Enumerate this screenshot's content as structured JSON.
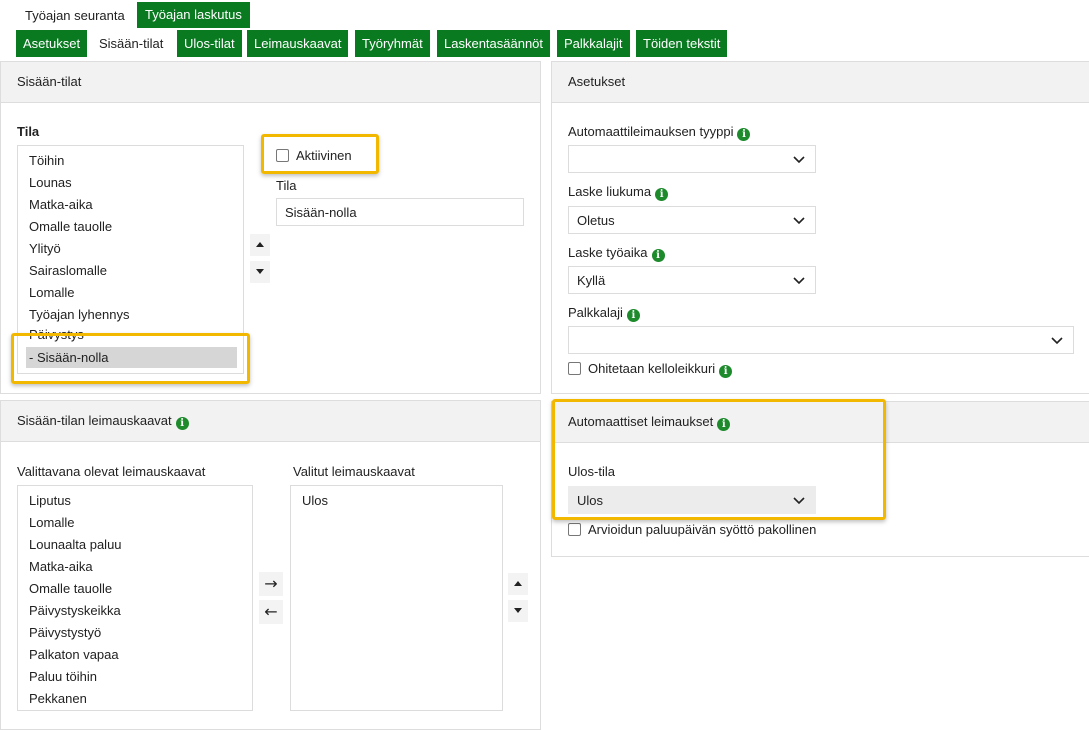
{
  "top_tabs": [
    "Työajan seuranta",
    "Työajan laskutus"
  ],
  "sub_tabs": [
    "Asetukset",
    "Sisään-tilat",
    "Ulos-tilat",
    "Leimauskaavat",
    "Työryhmät",
    "Laskentasäännöt",
    "Palkkalajit",
    "Töiden tekstit"
  ],
  "left_panel": {
    "title": "Sisään-tilat",
    "tila_label": "Tila",
    "states": [
      "Töihin",
      "Lounas",
      "Matka-aika",
      "Omalle tauolle",
      "Ylityö",
      "Sairaslomalle",
      "Lomalle",
      "Työajan lyhennys",
      "Päivystys",
      "- Sisään-nolla"
    ],
    "selected_state": "- Sisään-nolla",
    "active_label": "Aktiivinen",
    "name_label": "Tila",
    "name_value": "Sisään-nolla"
  },
  "right_panel": {
    "title": "Asetukset",
    "auto_type_label": "Automaattileimauksen tyyppi",
    "auto_type_value": "",
    "slide_label": "Laske liukuma",
    "slide_value": "Oletus",
    "worktime_label": "Laske työaika",
    "worktime_value": "Kyllä",
    "wage_label": "Palkkalaji",
    "wage_value": "",
    "skip_clock_label": "Ohitetaan kelloleikkuri"
  },
  "stamp_panel": {
    "title": "Sisään-tilan leimauskaavat",
    "available_label": "Valittavana olevat leimauskaavat",
    "available": [
      "Liputus",
      "Lomalle",
      "Lounaalta paluu",
      "Matka-aika",
      "Omalle tauolle",
      "Päivystyskeikka",
      "Päivystystyö",
      "Palkaton vapaa",
      "Paluu töihin",
      "Pekkanen"
    ],
    "selected_label": "Valitut leimauskaavat",
    "selected": [
      "Ulos"
    ]
  },
  "auto_panel": {
    "title": "Automaattiset leimaukset",
    "out_state_label": "Ulos-tila",
    "out_state_value": "Ulos",
    "return_date_label": "Arvioidun paluupäivän syöttö pakollinen"
  },
  "colors": {
    "green": "#0a7a21",
    "highlight": "#f2b800"
  },
  "icons": {
    "info": "info-icon",
    "chevron": "chevron-down-icon"
  }
}
